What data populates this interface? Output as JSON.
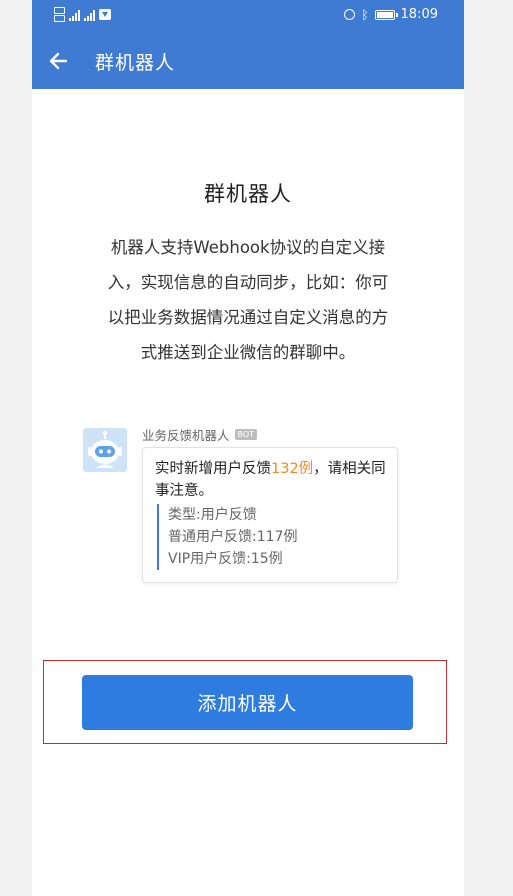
{
  "status_bar": {
    "time": "18:09",
    "left_icons": [
      "hd-icon",
      "signal-icon",
      "signal-icon",
      "app-notification-icon"
    ],
    "right_icons": [
      "alarm-icon",
      "bluetooth-icon",
      "battery-icon"
    ]
  },
  "nav": {
    "back_icon": "arrow-left-icon",
    "title": "群机器人"
  },
  "intro": {
    "title": "群机器人",
    "lines": [
      "机器人支持Webhook协议的自定义接",
      "入，实现信息的自动同步，比如：你可",
      "以把业务数据情况通过自定义消息的方",
      "式推送到企业微信的群聊中。"
    ]
  },
  "example": {
    "bot_name": "业务反馈机器人",
    "badge": "BOT",
    "message_prefix": "实时新增用户反馈",
    "message_highlight": "132例",
    "message_suffix": "，请相关同事注意。",
    "details": [
      "类型:用户反馈",
      "普通用户反馈:117例",
      "VIP用户反馈:15例"
    ]
  },
  "action": {
    "add_button_label": "添加机器人"
  },
  "colors": {
    "primary": "#3f7bd2",
    "button": "#2e7ce0",
    "highlight": "#f08a24"
  }
}
